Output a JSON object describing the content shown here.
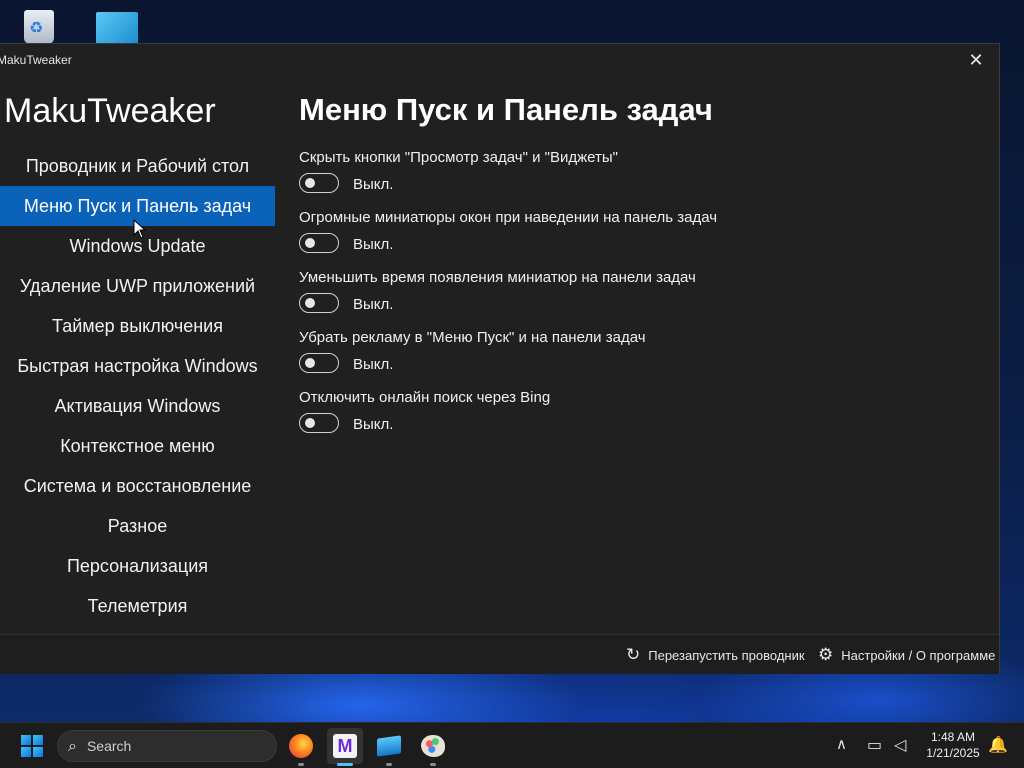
{
  "window": {
    "title": "MakuTweaker",
    "close_glyph": "✕"
  },
  "app_title": "MakuTweaker",
  "sidebar": {
    "items": [
      {
        "label": "Проводник и Рабочий стол",
        "active": false
      },
      {
        "label": "Меню Пуск и Панель задач",
        "active": true
      },
      {
        "label": "Windows Update",
        "active": false
      },
      {
        "label": "Удаление UWP приложений",
        "active": false
      },
      {
        "label": "Таймер выключения",
        "active": false
      },
      {
        "label": "Быстрая настройка Windows",
        "active": false
      },
      {
        "label": "Активация Windows",
        "active": false
      },
      {
        "label": "Контекстное меню",
        "active": false
      },
      {
        "label": "Система и восстановление",
        "active": false
      },
      {
        "label": "Разное",
        "active": false
      },
      {
        "label": "Персонализация",
        "active": false
      },
      {
        "label": "Телеметрия",
        "active": false
      }
    ]
  },
  "page": {
    "title": "Меню Пуск и Панель задач",
    "settings": [
      {
        "label": "Скрыть кнопки \"Просмотр задач\" и \"Виджеты\"",
        "state": "Выкл."
      },
      {
        "label": "Огромные миниатюры окон при наведении на панель задач",
        "state": "Выкл."
      },
      {
        "label": "Уменьшить время появления миниатюр на панели задач",
        "state": "Выкл."
      },
      {
        "label": "Убрать рекламу в \"Меню Пуск\" и на панели задач",
        "state": "Выкл."
      },
      {
        "label": "Отключить онлайн поиск через Bing",
        "state": "Выкл."
      }
    ]
  },
  "footer": {
    "restart_label": "Перезапустить проводник",
    "restart_icon": "refresh-icon",
    "settings_label": "Настройки / О программе",
    "settings_icon": "gear-icon"
  },
  "taskbar": {
    "search_placeholder": "Search",
    "time": "1:48 AM",
    "date": "1/21/2025",
    "apps": [
      "firefox",
      "makutweaker",
      "windows-sandbox",
      "paint"
    ]
  },
  "colors": {
    "accent": "#0a63b8",
    "window_bg": "#202020",
    "taskbar_accent": "#4cc2ff"
  }
}
